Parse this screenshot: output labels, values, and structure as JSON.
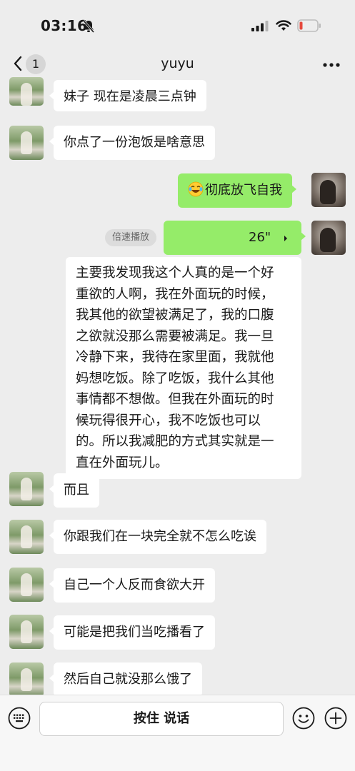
{
  "status_bar": {
    "time": "03:16",
    "icons": [
      "bell-off-icon",
      "signal-icon",
      "wifi-icon",
      "battery-low-icon"
    ],
    "battery_color": "#e5483c"
  },
  "nav": {
    "back_count": "1",
    "title": "yuyu",
    "icons": [
      "back-icon",
      "more-icon"
    ]
  },
  "colors": {
    "background": "#ededed",
    "sent_bubble": "#95ec69",
    "received_bubble": "#ffffff"
  },
  "messages": [
    {
      "side": "left",
      "text": "妹子 现在是凌晨三点钟"
    },
    {
      "side": "left",
      "text": "你点了一份泡饭是啥意思"
    },
    {
      "side": "right",
      "emoji": "laughing-tears-emoji",
      "text": "彻底放飞自我"
    },
    {
      "side": "right",
      "type": "voice",
      "duration": "26\"",
      "speed_label": "倍速播放"
    },
    {
      "side": "left",
      "text": "而且"
    },
    {
      "side": "left",
      "text": "你跟我们在一块完全就不怎么吃诶"
    },
    {
      "side": "left",
      "text": "自己一个人反而食欲大开"
    },
    {
      "side": "left",
      "text": "可能是把我们当吃播看了"
    },
    {
      "side": "left",
      "text": "然后自己就没那么饿了"
    }
  ],
  "transcript": {
    "lines": [
      "主要我发现我这个人真的是一个好",
      "重欲的人啊，我在外面玩的时候，",
      "我其他的欲望被满足了，我的口腹",
      "之欲就没那么需要被满足。我一旦",
      "冷静下来，我待在家里面，我就他",
      "妈想吃饭。除了吃饭，我什么其他",
      "事情都不想做。但我在外面玩的时",
      "候玩得很开心，我不吃饭也可以",
      "的。所以我减肥的方式其实就是一",
      "直在外面玩儿。"
    ]
  },
  "input_bar": {
    "hold_to_talk": "按住 说话",
    "icons": [
      "keyboard-icon",
      "emoji-icon",
      "plus-icon"
    ]
  }
}
